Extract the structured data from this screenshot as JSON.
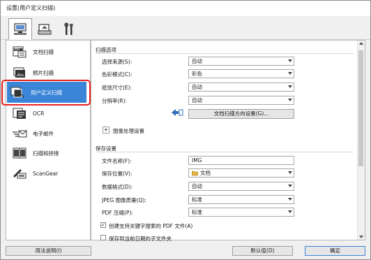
{
  "window": {
    "title": "设置(用户定义扫描)"
  },
  "toolbar": {
    "tabs": [
      {
        "icon": "scanner-computer-icon",
        "active": true
      },
      {
        "icon": "scanner-output-icon",
        "active": false
      },
      {
        "icon": "tools-icon",
        "active": false
      }
    ]
  },
  "sidebar": {
    "items": [
      {
        "label": "文档扫描",
        "icon": "document-scan-icon"
      },
      {
        "label": "照片扫描",
        "icon": "photo-scan-icon"
      },
      {
        "label": "用户定义扫描",
        "icon": "custom-scan-icon",
        "selected": true
      },
      {
        "label": "OCR",
        "icon": "ocr-icon"
      },
      {
        "label": "电子邮件",
        "icon": "email-icon"
      },
      {
        "label": "扫描和拼接",
        "icon": "stitch-icon"
      },
      {
        "label": "ScanGear",
        "icon": "scangear-icon"
      }
    ]
  },
  "scan_options": {
    "section_title": "扫描选项",
    "fields": [
      {
        "label": "选择来源(S):",
        "value": "自动"
      },
      {
        "label": "色彩模式(C):",
        "value": "彩色"
      },
      {
        "label": "纸张尺寸(E):",
        "value": "自动"
      },
      {
        "label": "分辨率(R):",
        "value": "自动"
      }
    ],
    "orientation_button": "文档扫描方向设置(G)...",
    "image_processing": "图像处理设置",
    "expander_symbol": "+"
  },
  "save_settings": {
    "section_title": "保存设置",
    "fields": [
      {
        "label": "文件名称(F):",
        "value": "IMG"
      },
      {
        "label": "保存位置(V):",
        "value": "文档"
      },
      {
        "label": "数据格式(D):",
        "value": "自动"
      },
      {
        "label": "JPEG 图像质量(Q):",
        "value": "标准"
      },
      {
        "label": "PDF 压缩(P):",
        "value": "标准"
      }
    ],
    "checkboxes": [
      {
        "label": "创建支持关键字搜索的 PDF 文件(A)",
        "checked": true
      },
      {
        "label": "保存到当前日期的子文件夹",
        "checked": false
      }
    ],
    "check_mark": "✓"
  },
  "footer": {
    "help": "用法说明(I)",
    "defaults": "默认值(D)",
    "ok": "确定"
  },
  "colors": {
    "selection": "#3a85d8",
    "highlight_frame": "#e8201f"
  }
}
